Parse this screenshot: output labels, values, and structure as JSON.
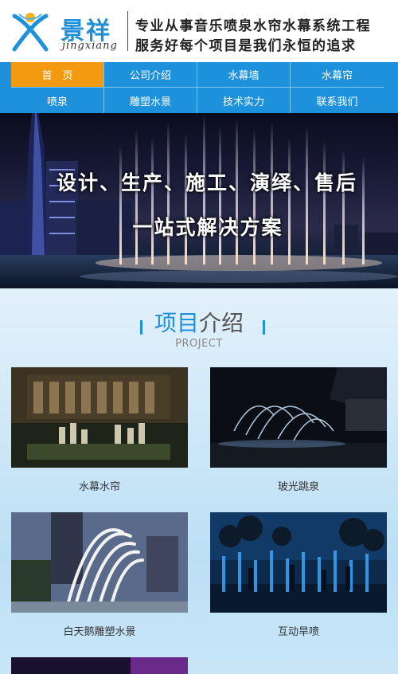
{
  "header": {
    "logo_cn": "景祥",
    "logo_en": "jingxiang",
    "slogan_line1": "专业从事音乐喷泉水帘水幕系统工程",
    "slogan_line2": "服务好每个项目是我们永恒的追求"
  },
  "nav": {
    "items": [
      {
        "label": "首　页",
        "active": true
      },
      {
        "label": "公司介绍"
      },
      {
        "label": "水幕墙"
      },
      {
        "label": "水幕帘"
      },
      {
        "label": "喷泉"
      },
      {
        "label": "雕塑水景"
      },
      {
        "label": "技术实力"
      },
      {
        "label": "联系我们"
      }
    ]
  },
  "banner": {
    "line1": "设计、生产、施工、演绎、售后",
    "line2": "一站式解决方案"
  },
  "project": {
    "title_a": "项目",
    "title_b": "介绍",
    "subtitle": "PROJECT",
    "cards": [
      {
        "caption": "水幕水帘"
      },
      {
        "caption": "玻光跳泉"
      },
      {
        "caption": "白天鹅雕塑水景"
      },
      {
        "caption": "互动旱喷"
      }
    ]
  },
  "colors": {
    "brand_blue": "#1e91dd",
    "active_orange": "#f39a10"
  }
}
